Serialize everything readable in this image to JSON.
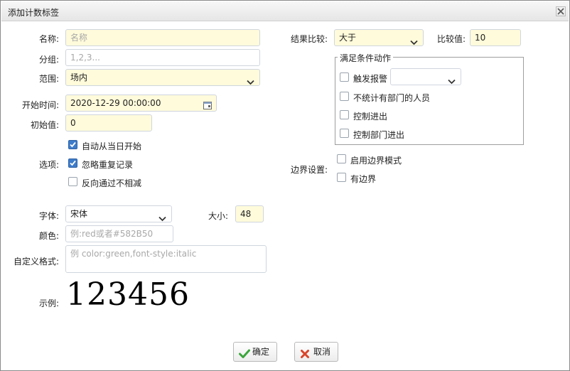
{
  "window": {
    "title": "添加计数标签"
  },
  "form": {
    "name": {
      "label": "名称:",
      "placeholder": "名称"
    },
    "group": {
      "label": "分组:",
      "placeholder": "1,2,3..."
    },
    "scope": {
      "label": "范围:",
      "value": "场内"
    },
    "start_time": {
      "label": "开始时间:",
      "value": "2020-12-29 00:00:00"
    },
    "initial_value": {
      "label": "初始值:",
      "value": "0"
    },
    "options": {
      "label": "选项:",
      "items": [
        {
          "label": "自动从当日开始",
          "checked": true
        },
        {
          "label": "忽略重复记录",
          "checked": true
        },
        {
          "label": "反向通过不相减",
          "checked": false
        }
      ]
    },
    "font": {
      "label": "字体:",
      "value": "宋体"
    },
    "size": {
      "label": "大小:",
      "value": "48"
    },
    "color": {
      "label": "颜色:",
      "placeholder": "例:red或者#582B50"
    },
    "custom_format": {
      "label": "自定义格式:",
      "placeholder": "例 color:green,font-style:italic"
    },
    "example": {
      "label": "示例:",
      "value": "123456"
    },
    "compare": {
      "label": "结果比较:",
      "value": "大于"
    },
    "compare_value": {
      "label": "比较值:",
      "value": "10"
    },
    "actions": {
      "legend": "满足条件动作",
      "alarm": {
        "label": "触发报警",
        "checked": false,
        "select_value": ""
      },
      "items": [
        {
          "label": "不统计有部门的人员",
          "checked": false
        },
        {
          "label": "控制进出",
          "checked": false
        },
        {
          "label": "控制部门进出",
          "checked": false
        }
      ]
    },
    "boundary": {
      "label": "边界设置:",
      "items": [
        {
          "label": "启用边界模式",
          "checked": false
        },
        {
          "label": "有边界",
          "checked": false
        }
      ]
    }
  },
  "buttons": {
    "ok": "确定",
    "cancel": "取消"
  },
  "colors": {
    "input_highlight": "#fffbdb",
    "checkbox_checked": "#3d7ccb",
    "ok_icon": "#3aa53a",
    "cancel_icon": "#d9442a"
  }
}
